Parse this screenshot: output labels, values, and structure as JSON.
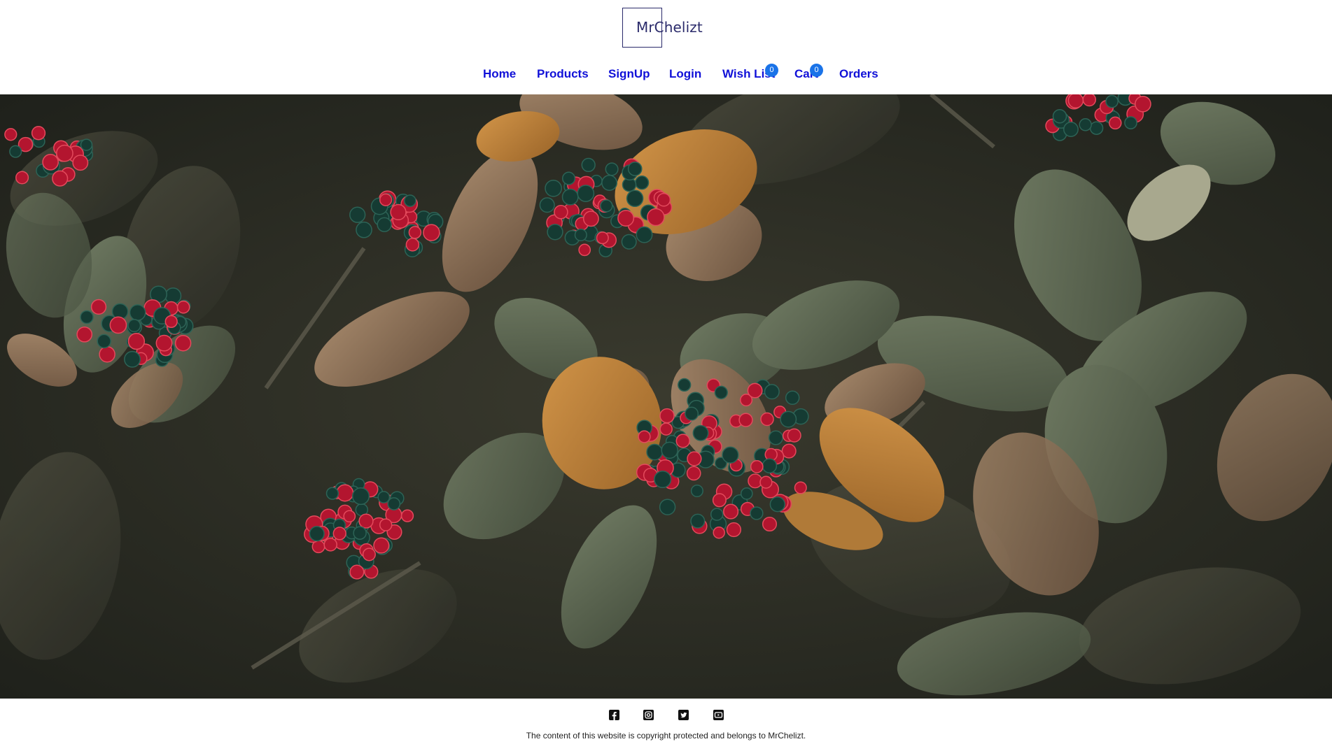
{
  "brand": {
    "logo_text": "MrChelizt"
  },
  "nav": {
    "home": "Home",
    "products": "Products",
    "signup": "SignUp",
    "login": "Login",
    "wishlist": "Wish List",
    "wishlist_count": "0",
    "cart": "Cart",
    "cart_count": "0",
    "orders": "Orders"
  },
  "colors": {
    "nav_link": "#1010d8",
    "badge": "#1a73e8",
    "logo": "#2b2b6b"
  },
  "hero": {
    "icon": "autumn-leaves-and-berries-photo"
  },
  "footer": {
    "social": [
      "facebook-icon",
      "instagram-icon",
      "twitter-icon",
      "youtube-icon"
    ],
    "copyright": "The content of this website is copyright protected and belongs to MrChelizt."
  }
}
